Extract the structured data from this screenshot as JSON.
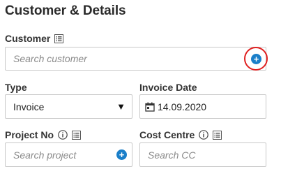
{
  "section": {
    "title": "Customer & Details"
  },
  "customer": {
    "label": "Customer",
    "placeholder": "Search customer",
    "add_icon": "plus-circle-icon",
    "highlight_color": "#e02020"
  },
  "type": {
    "label": "Type",
    "value": "Invoice",
    "arrow": "▼"
  },
  "invoice_date": {
    "label": "Invoice Date",
    "value": "14.09.2020",
    "icon": "calendar-icon"
  },
  "project": {
    "label": "Project No",
    "placeholder": "Search project",
    "add_icon": "plus-circle-icon"
  },
  "cost_centre": {
    "label": "Cost Centre",
    "placeholder": "Search CC"
  },
  "colors": {
    "accent": "#1a7fc9",
    "border": "#c9c9c9",
    "text": "#222222",
    "placeholder": "#8a8a8a"
  },
  "plus_glyph": "+"
}
